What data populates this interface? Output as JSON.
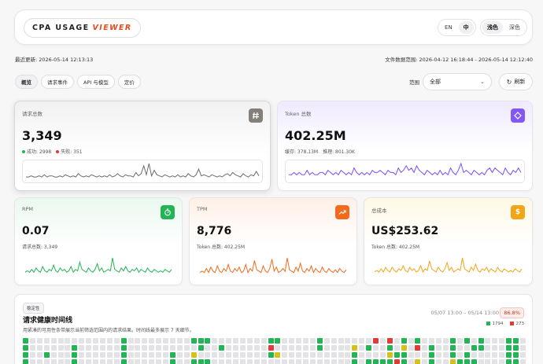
{
  "header": {
    "brand_main": "CPA USAGE",
    "brand_accent": "VIEWER",
    "lang_options": [
      "EN",
      "中"
    ],
    "lang_active": "中",
    "theme_options": [
      "浅色",
      "深色"
    ],
    "theme_active": "浅色"
  },
  "meta": {
    "last_updated": "最近更新: 2026-05-14 12:13:13",
    "file_range": "文件数据范围: 2026-04-12 16:18:44 - 2026-05-14 12:12:40"
  },
  "nav": {
    "tabs": [
      "概览",
      "请求事件",
      "API 与模型",
      "定价"
    ],
    "active": "概览",
    "range_label": "范围",
    "range_value": "全部",
    "refresh_label": "刷新"
  },
  "cards": {
    "requests": {
      "title": "请求总数",
      "value": "3,349",
      "success": "成功: 2998",
      "fail": "失败: 351",
      "color": "#6b6b6b",
      "icon": "hash-icon",
      "spark": [
        2,
        2,
        3,
        2,
        2,
        3,
        2,
        4,
        2,
        3,
        3,
        2,
        2,
        3,
        2,
        4,
        3,
        2,
        3,
        2,
        5,
        3,
        2,
        3,
        2,
        4,
        3,
        2,
        3,
        2,
        3,
        2,
        4,
        2,
        3,
        5,
        3,
        2,
        4,
        3,
        3,
        2,
        6,
        3,
        5,
        12,
        4,
        14,
        3,
        8,
        4,
        3,
        2,
        4,
        3,
        2,
        3,
        2,
        4,
        2,
        3,
        2,
        5,
        3,
        2,
        4,
        9,
        3,
        4,
        3,
        2,
        4,
        3,
        2,
        3,
        2,
        4,
        5,
        3,
        6,
        4,
        3,
        2,
        5,
        3,
        2,
        4,
        3,
        7,
        3
      ]
    },
    "tokens": {
      "title": "Token 总数",
      "value": "402.25M",
      "cache": "缓存: 378.13M",
      "reasoning": "推理: 801.30K",
      "color": "#7c4dff",
      "icon": "diamond-icon",
      "spark": [
        2,
        2,
        3,
        2,
        3,
        2,
        2,
        4,
        2,
        3,
        2,
        2,
        3,
        3,
        2,
        4,
        3,
        2,
        3,
        2,
        4,
        3,
        2,
        3,
        2,
        5,
        3,
        2,
        3,
        2,
        3,
        2,
        4,
        3,
        3,
        4,
        3,
        2,
        4,
        3,
        3,
        2,
        5,
        3,
        4,
        6,
        4,
        5,
        3,
        6,
        4,
        3,
        2,
        4,
        3,
        2,
        3,
        2,
        4,
        2,
        3,
        2,
        5,
        3,
        2,
        4,
        7,
        3,
        4,
        3,
        2,
        4,
        3,
        2,
        3,
        2,
        4,
        5,
        3,
        5,
        4,
        3,
        2,
        5,
        3,
        2,
        4,
        3,
        5,
        3
      ]
    },
    "rpm": {
      "title": "RPM",
      "value": "0.07",
      "sub": "请求总数: 3,349",
      "color": "#22b455",
      "icon": "timer-icon",
      "spark": [
        2,
        3,
        2,
        4,
        2,
        5,
        3,
        2,
        6,
        3,
        2,
        4,
        3,
        7,
        3,
        2,
        5,
        3,
        4,
        2,
        3,
        6,
        2,
        4,
        3,
        9,
        4,
        3,
        2,
        5,
        3,
        2,
        4,
        8,
        3,
        5,
        2,
        3,
        4,
        3,
        12,
        4,
        3,
        2,
        5,
        3,
        6,
        3,
        2,
        4,
        3,
        5,
        2,
        4,
        3,
        2,
        5,
        3,
        2,
        4,
        3,
        2,
        3,
        2,
        4,
        3,
        2,
        4
      ]
    },
    "tpm": {
      "title": "TPM",
      "value": "8,776",
      "sub": "Token 总数: 402.25M",
      "color": "#f26a1b",
      "icon": "trend-icon",
      "spark": [
        2,
        3,
        2,
        5,
        2,
        6,
        3,
        2,
        7,
        3,
        2,
        5,
        3,
        8,
        3,
        2,
        5,
        3,
        6,
        2,
        3,
        8,
        2,
        5,
        3,
        11,
        4,
        3,
        2,
        7,
        3,
        2,
        5,
        12,
        3,
        6,
        2,
        3,
        5,
        3,
        13,
        4,
        3,
        2,
        6,
        3,
        9,
        3,
        2,
        5,
        3,
        7,
        2,
        5,
        3,
        2,
        6,
        3,
        2,
        5,
        3,
        2,
        4,
        2,
        5,
        3,
        2,
        4
      ]
    },
    "cost": {
      "title": "总成本",
      "value": "US$253.62",
      "sub": "Token 总数: 402.25M",
      "color": "#f2a516",
      "icon": "dollar-icon",
      "spark": [
        2,
        3,
        2,
        4,
        2,
        5,
        3,
        2,
        5,
        3,
        2,
        4,
        3,
        6,
        3,
        2,
        5,
        3,
        4,
        2,
        3,
        6,
        2,
        4,
        3,
        9,
        4,
        3,
        2,
        5,
        3,
        2,
        4,
        8,
        3,
        5,
        2,
        3,
        4,
        3,
        11,
        4,
        3,
        2,
        5,
        3,
        7,
        3,
        2,
        4,
        3,
        5,
        2,
        4,
        3,
        2,
        5,
        3,
        2,
        4,
        3,
        2,
        3,
        2,
        4,
        3,
        2,
        4
      ]
    }
  },
  "health": {
    "badge": "稳定性",
    "title": "请求健康时间线",
    "description": "用紧凑的可用性条带展示当前筛选范围内的请求结果。时间线最多展示 7 天细节。",
    "range": "05/07 13:00 – 05/14 13:00",
    "percent": "86.8%",
    "success_count": "1794",
    "fail_count": "273",
    "colors": {
      "success": "#22b455",
      "fail": "#e53935",
      "partial": "#d4c21a",
      "empty": "#e3e3e6"
    }
  }
}
